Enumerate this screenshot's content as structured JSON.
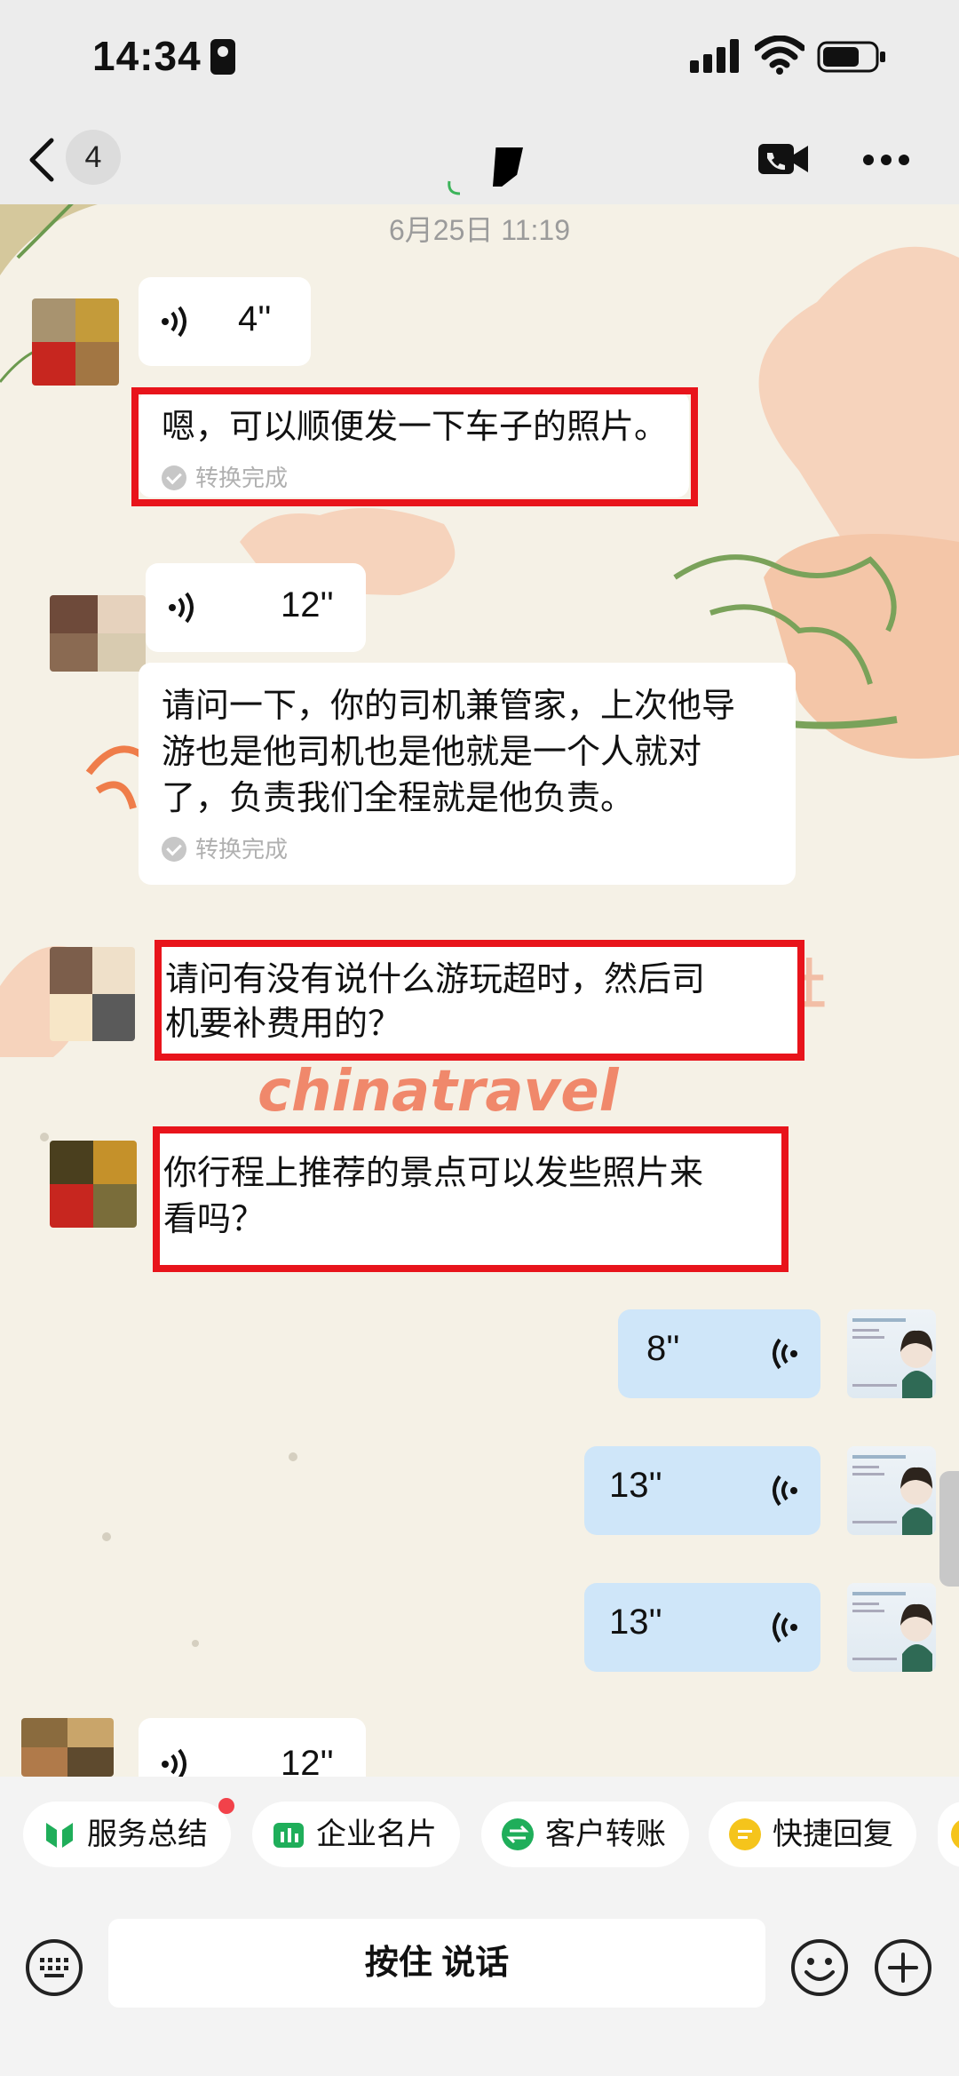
{
  "status_bar": {
    "time": "14:34"
  },
  "nav": {
    "unread_count": "4"
  },
  "chat": {
    "timestamp": "6月25日 11:19",
    "messages": [
      {
        "voice_duration": "4''",
        "text": "嗯，可以顺便发一下车子的照片。",
        "status": "转换完成"
      },
      {
        "voice_duration": "12''",
        "text_lines": [
          "请问一下，你的司机兼管家，上次他导",
          "游也是他司机也是他就是一个人就对",
          "了，负责我们全程就是他负责。"
        ],
        "status": "转换完成"
      },
      {
        "text_lines": [
          "请问有没有说什么游玩超时，然后司",
          "机要补费用的？"
        ]
      },
      {
        "text_lines": [
          "你行程上推荐的景点可以发些照片来",
          "看吗？"
        ]
      }
    ],
    "outgoing": [
      {
        "voice_duration": "8''"
      },
      {
        "voice_duration": "13''"
      },
      {
        "voice_duration": "13''"
      }
    ],
    "last_incoming_voice": "12''",
    "watermark": "chinatravel"
  },
  "quick_actions": [
    {
      "label": "服务总结",
      "icon": "service-summary-icon"
    },
    {
      "label": "企业名片",
      "icon": "business-card-icon"
    },
    {
      "label": "客户转账",
      "icon": "transfer-icon"
    },
    {
      "label": "快捷回复",
      "icon": "quick-reply-icon"
    }
  ],
  "input": {
    "hold_to_talk": "按住 说话"
  },
  "colors": {
    "highlight_red": "#e8141b",
    "outgoing_bubble": "#cfe6f9",
    "bg": "#f5f1e6"
  }
}
